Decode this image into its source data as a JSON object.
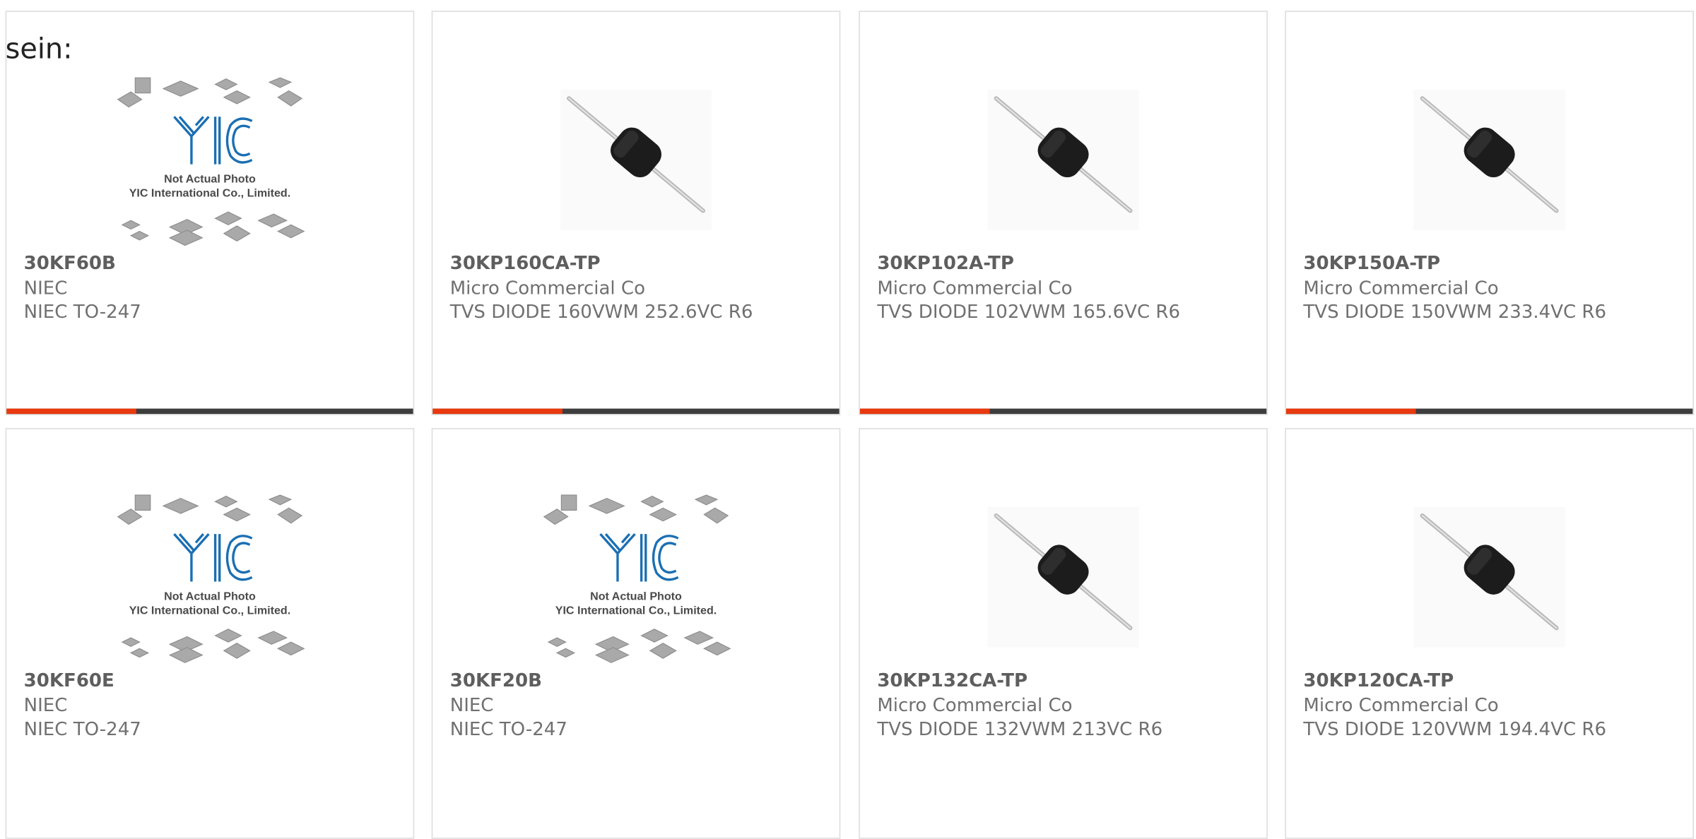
{
  "heading": "sein:",
  "colors": {
    "accent": "#e8380d",
    "bar_bg": "#3d3d3d",
    "text": "#707070",
    "yic_blue": "#1b6fb3"
  },
  "placeholder_image": {
    "line1": "Not Actual Photo",
    "line2": "YIC International Co., Limited."
  },
  "products": [
    {
      "part": "30KF60B",
      "maker": "NIEC",
      "description": "NIEC TO-247",
      "image": "yic-placeholder-image",
      "progress": 0.32
    },
    {
      "part": "30KP160CA-TP",
      "maker": "Micro Commercial Co",
      "description": "TVS DIODE 160VWM 252.6VC R6",
      "image": "axial-diode-image",
      "progress": 0.32
    },
    {
      "part": "30KP102A-TP",
      "maker": "Micro Commercial Co",
      "description": "TVS DIODE 102VWM 165.6VC R6",
      "image": "axial-diode-image",
      "progress": 0.32
    },
    {
      "part": "30KP150A-TP",
      "maker": "Micro Commercial Co",
      "description": "TVS DIODE 150VWM 233.4VC R6",
      "image": "axial-diode-image",
      "progress": 0.32
    },
    {
      "part": "30KF60E",
      "maker": "NIEC",
      "description": "NIEC TO-247",
      "image": "yic-placeholder-image"
    },
    {
      "part": "30KF20B",
      "maker": "NIEC",
      "description": "NIEC TO-247",
      "image": "yic-placeholder-image"
    },
    {
      "part": "30KP132CA-TP",
      "maker": "Micro Commercial Co",
      "description": "TVS DIODE 132VWM 213VC R6",
      "image": "axial-diode-image"
    },
    {
      "part": "30KP120CA-TP",
      "maker": "Micro Commercial Co",
      "description": "TVS DIODE 120VWM 194.4VC R6",
      "image": "axial-diode-image"
    }
  ]
}
